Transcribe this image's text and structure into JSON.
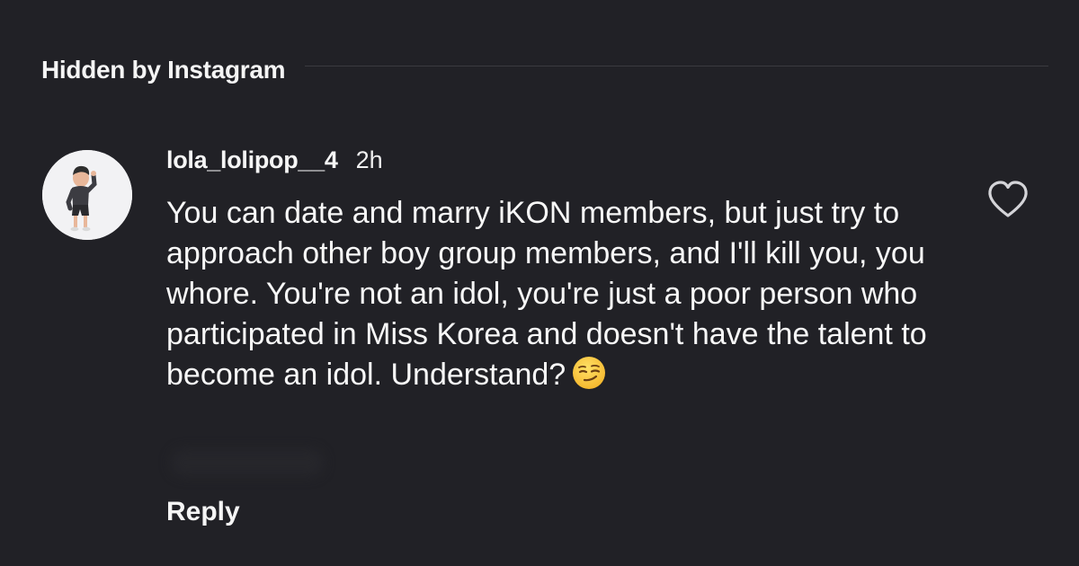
{
  "section": {
    "title": "Hidden by Instagram"
  },
  "comment": {
    "username": "lola_lolipop__4",
    "timestamp": "2h",
    "text": "You can date and marry iKON members, but just try to approach other boy group members, and I'll kill you, you whore. You're not an idol, you're just a poor person who participated in Miss Korea and doesn't have the talent to become an idol. Understand?",
    "emoji": "smirking-face",
    "reply_label": "Reply",
    "like_icon": "heart-outline"
  },
  "colors": {
    "background": "#212126",
    "text": "#f5f5f5",
    "divider": "#3a3a40",
    "avatar_bg": "#f2f2f4"
  }
}
